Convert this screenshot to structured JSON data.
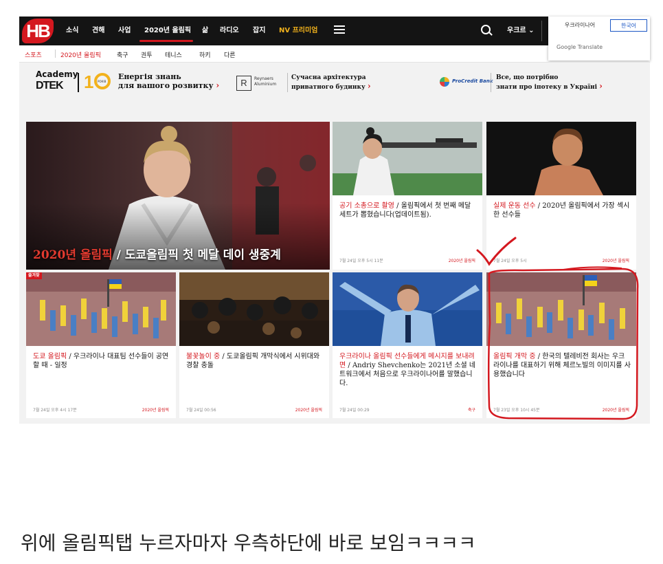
{
  "header": {
    "logo": "HB",
    "nav_items": [
      "소식",
      "견해",
      "사업",
      "2020년 올림픽",
      "삶",
      "라디오",
      "잡지",
      "NV 프리미엄"
    ],
    "language_select": "우크르 ⌄",
    "colors": {
      "bar": "#141414",
      "accent": "#d4181f",
      "premium": "#f2b21c"
    }
  },
  "translate_popup": {
    "lang_from": "우크라이나어",
    "lang_to": "한국어",
    "label": "Google Translate"
  },
  "subnav": [
    "스포츠",
    "2020년 올림픽",
    "축구",
    "권투",
    "테니스",
    "하키",
    "다른"
  ],
  "ads": {
    "academy": "Academy",
    "dtek": "DTEK",
    "ten_caption": "РОКІВ",
    "ad1_text_1": "Енергія знань",
    "ad1_text_2": "для вашого розвитку",
    "reynaers_1": "Reynaers",
    "reynaers_2": "Aluminium",
    "ad2_text_1": "Сучасна архітектура",
    "ad2_text_2": "приватного будинку",
    "procredit": "ProCredit Bank",
    "ad3_text_1": "Все, що потрібно",
    "ad3_text_2": "знати про іпотеку в Україні",
    "arrow": "›"
  },
  "hero": {
    "category": "2020년 올림픽",
    "sep": " / ",
    "title": "도쿄올림픽 첫 메달 데이 생중계"
  },
  "cards": [
    {
      "category": "공기 소총으로 촬영",
      "title": "올림픽에서 첫 번째 메달 세트가 뽑혔습니다(업데이트됨).",
      "time": "7월 24일 오후 5시 11분",
      "tag": "2020년 올림픽"
    },
    {
      "category": "실제 운동 선수",
      "title": "2020년 올림픽에서 가장 섹시한 선수들",
      "time": "7월 24일 오후 5시",
      "tag": "2020년 올림픽"
    },
    {
      "badge": "즐겨찾",
      "category": "도쿄 올림픽",
      "title": "우크라이나 대표팀 선수들이 공연할 때 - 일정",
      "time": "7월 24일 오후 4시 17분",
      "tag": "2020년 올림픽"
    },
    {
      "category": "불꽃놀이 중",
      "title": "도쿄올림픽 개막식에서 시위대와 경찰 충돌",
      "time": "7월 24일 00:56",
      "tag": "2020년 올림픽"
    },
    {
      "category": "우크라이나 올림픽 선수들에게 메시지를 보내려면",
      "title": "Andriy Shevchenko는 2021년 소셜 네트워크에서 처음으로 우크라이나어를 말했습니다.",
      "time": "7월 24일 00:29",
      "tag": "축구"
    },
    {
      "category": "올림픽 개막 중",
      "title": "한국의 텔레비전 회사는 우크라이나를 대표하기 위해 체르노빌의 이미지를 사용했습니다",
      "time": "7월 23일 오후 10시 45분",
      "tag": "2020년 올림픽"
    }
  ],
  "caption": "위에 올림픽탭 누르자마자 우측하단에 바로 보임ㅋㅋㅋㅋ",
  "annotation_color": "#d4181f"
}
